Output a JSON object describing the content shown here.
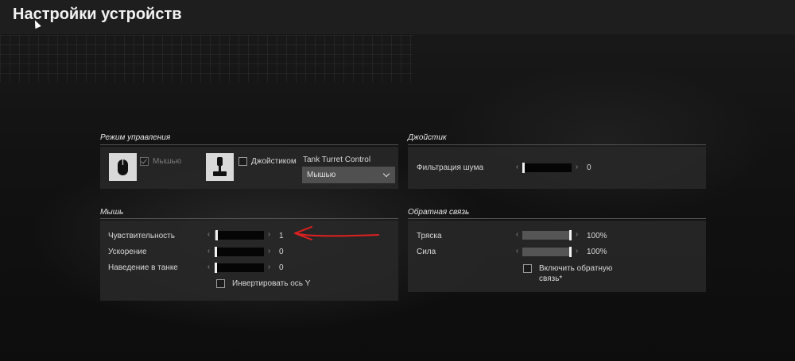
{
  "header": {
    "title": "Настройки устройств"
  },
  "control_mode": {
    "title": "Режим управления",
    "mouse_label": "Мышью",
    "mouse_checked": true,
    "joystick_label": "Джойстиком",
    "joystick_checked": false,
    "tank_turret_label": "Tank Turret Control",
    "tank_turret_value": "Мышью"
  },
  "joystick": {
    "title": "Джойстик",
    "noise_filter": {
      "label": "Фильтрация шума",
      "value": "0",
      "fraction": 0.0
    }
  },
  "mouse": {
    "title": "Мышь",
    "sensitivity": {
      "label": "Чувствительность",
      "value": "1",
      "fraction": 0.01
    },
    "acceleration": {
      "label": "Ускорение",
      "value": "0",
      "fraction": 0.0
    },
    "tank_aim": {
      "label": "Наведение в танке",
      "value": "0",
      "fraction": 0.0
    },
    "invert_y": {
      "label": "Инвертировать ось Y",
      "checked": false
    }
  },
  "feedback": {
    "title": "Обратная связь",
    "shake": {
      "label": "Тряска",
      "value": "100%",
      "fraction": 1.0
    },
    "force": {
      "label": "Сила",
      "value": "100%",
      "fraction": 1.0
    },
    "enable_label": "Включить обратную связь*",
    "enable_checked": false
  },
  "icons": {
    "prev": "‹",
    "next": "›",
    "mouse_tile": "mouse-icon",
    "joystick_tile": "joystick-icon"
  },
  "colors": {
    "annotation": "#e02020",
    "panel": "#282828",
    "accent_thumb": "#f2f2f2"
  }
}
